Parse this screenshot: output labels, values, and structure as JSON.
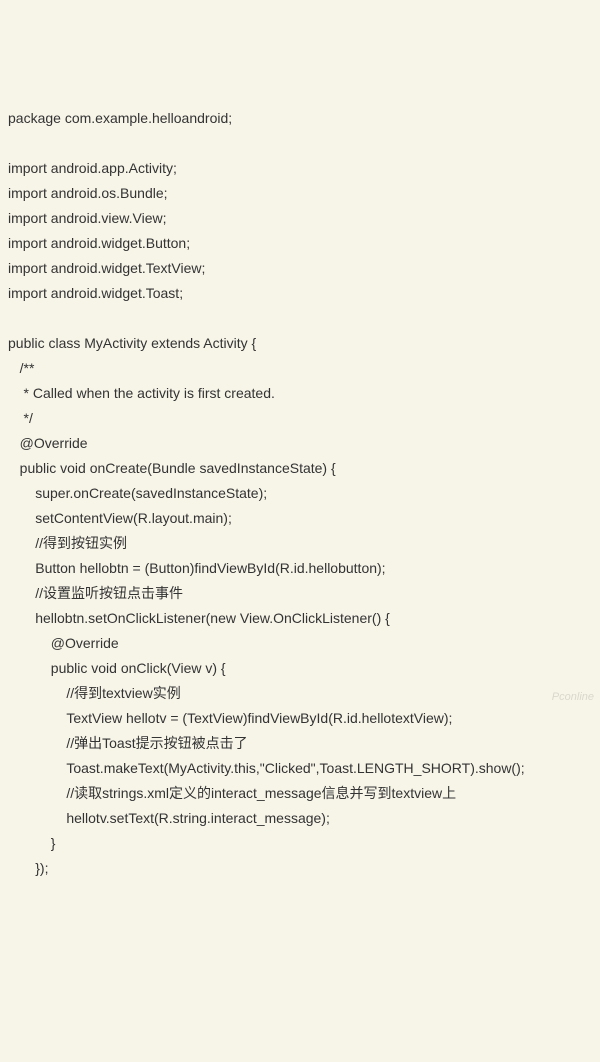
{
  "code": {
    "lines": [
      "package com.example.helloandroid;",
      "",
      "import android.app.Activity;",
      "import android.os.Bundle;",
      "import android.view.View;",
      "import android.widget.Button;",
      "import android.widget.TextView;",
      "import android.widget.Toast;",
      "",
      "public class MyActivity extends Activity {",
      "   /**",
      "    * Called when the activity is first created.",
      "    */",
      "   @Override",
      "   public void onCreate(Bundle savedInstanceState) {",
      "       super.onCreate(savedInstanceState);",
      "       setContentView(R.layout.main);",
      "       //得到按钮实例",
      "       Button hellobtn = (Button)findViewById(R.id.hellobutton);",
      "       //设置监听按钮点击事件",
      "       hellobtn.setOnClickListener(new View.OnClickListener() {",
      "           @Override",
      "           public void onClick(View v) {",
      "               //得到textview实例",
      "               TextView hellotv = (TextView)findViewById(R.id.hellotextView);",
      "               //弹出Toast提示按钮被点击了",
      "               Toast.makeText(MyActivity.this,\"Clicked\",Toast.LENGTH_SHORT).show();",
      "               //读取strings.xml定义的interact_message信息并写到textview上",
      "               hellotv.setText(R.string.interact_message);",
      "           }",
      "       });"
    ]
  },
  "watermark": "Pconline"
}
